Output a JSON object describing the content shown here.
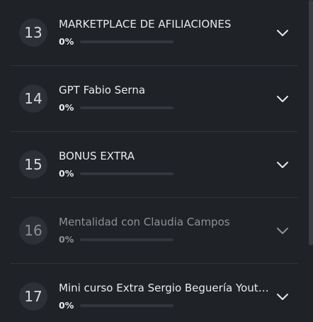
{
  "modules": [
    {
      "number": "13",
      "title": "MARKETPLACE DE AFILIACIONES",
      "progress_label": "0%",
      "progress": 0,
      "dimmed": false
    },
    {
      "number": "14",
      "title": "GPT Fabio Serna",
      "progress_label": "0%",
      "progress": 0,
      "dimmed": false
    },
    {
      "number": "15",
      "title": "BONUS EXTRA",
      "progress_label": "0%",
      "progress": 0,
      "dimmed": false
    },
    {
      "number": "16",
      "title": "Mentalidad con Claudia Campos",
      "progress_label": "0%",
      "progress": 0,
      "dimmed": true
    },
    {
      "number": "17",
      "title": "Mini curso Extra Sergio Beguería Youtube",
      "progress_label": "0%",
      "progress": 0,
      "dimmed": false
    }
  ],
  "icons": {
    "expand": "chevron-down-icon"
  },
  "colors": {
    "background": "#1f2227",
    "divider": "#30343a",
    "track": "#33373d",
    "text": "#e9eaec"
  }
}
